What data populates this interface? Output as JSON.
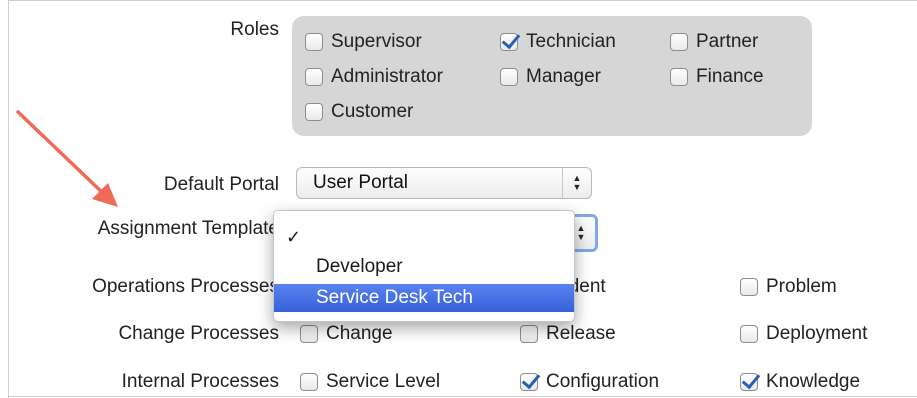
{
  "form": {
    "roles_label": "Roles",
    "roles": [
      {
        "label": "Supervisor",
        "checked": false
      },
      {
        "label": "Technician",
        "checked": true
      },
      {
        "label": "Partner",
        "checked": false
      },
      {
        "label": "Administrator",
        "checked": false
      },
      {
        "label": "Manager",
        "checked": false
      },
      {
        "label": "Finance",
        "checked": false
      },
      {
        "label": "Customer",
        "checked": false
      }
    ],
    "default_portal_label": "Default Portal",
    "default_portal_value": "User Portal",
    "assignment_template_label": "Assignment Template",
    "assignment_template_value": "",
    "operations_label": "Operations Processes",
    "operations": [
      {
        "label": "Incident",
        "visible_text": "cident",
        "checked": false
      },
      {
        "label": "Problem",
        "checked": false
      }
    ],
    "change_label": "Change Processes",
    "change": [
      {
        "label": "Change",
        "checked": false
      },
      {
        "label": "Release",
        "checked": false
      },
      {
        "label": "Deployment",
        "checked": false
      }
    ],
    "internal_label": "Internal Processes",
    "internal": [
      {
        "label": "Service Level",
        "checked": false
      },
      {
        "label": "Configuration",
        "checked": true
      },
      {
        "label": "Knowledge",
        "checked": true
      }
    ]
  },
  "dropdown": {
    "items": [
      {
        "label": "",
        "selected": true,
        "check": "✓"
      },
      {
        "label": "Developer",
        "selected": false
      },
      {
        "label": "Service Desk Tech",
        "selected": false,
        "highlighted": true
      }
    ]
  },
  "colors": {
    "roles_box": "#d6d6d6",
    "highlight": "#3a64dc",
    "checkmark": "#2a5fb3",
    "annotation_arrow": "#f06a5a",
    "focus_ring": "#7fa9e8"
  },
  "icons": {
    "select_arrow": "up-down-chevron-icon",
    "annotation": "arrow-icon"
  }
}
